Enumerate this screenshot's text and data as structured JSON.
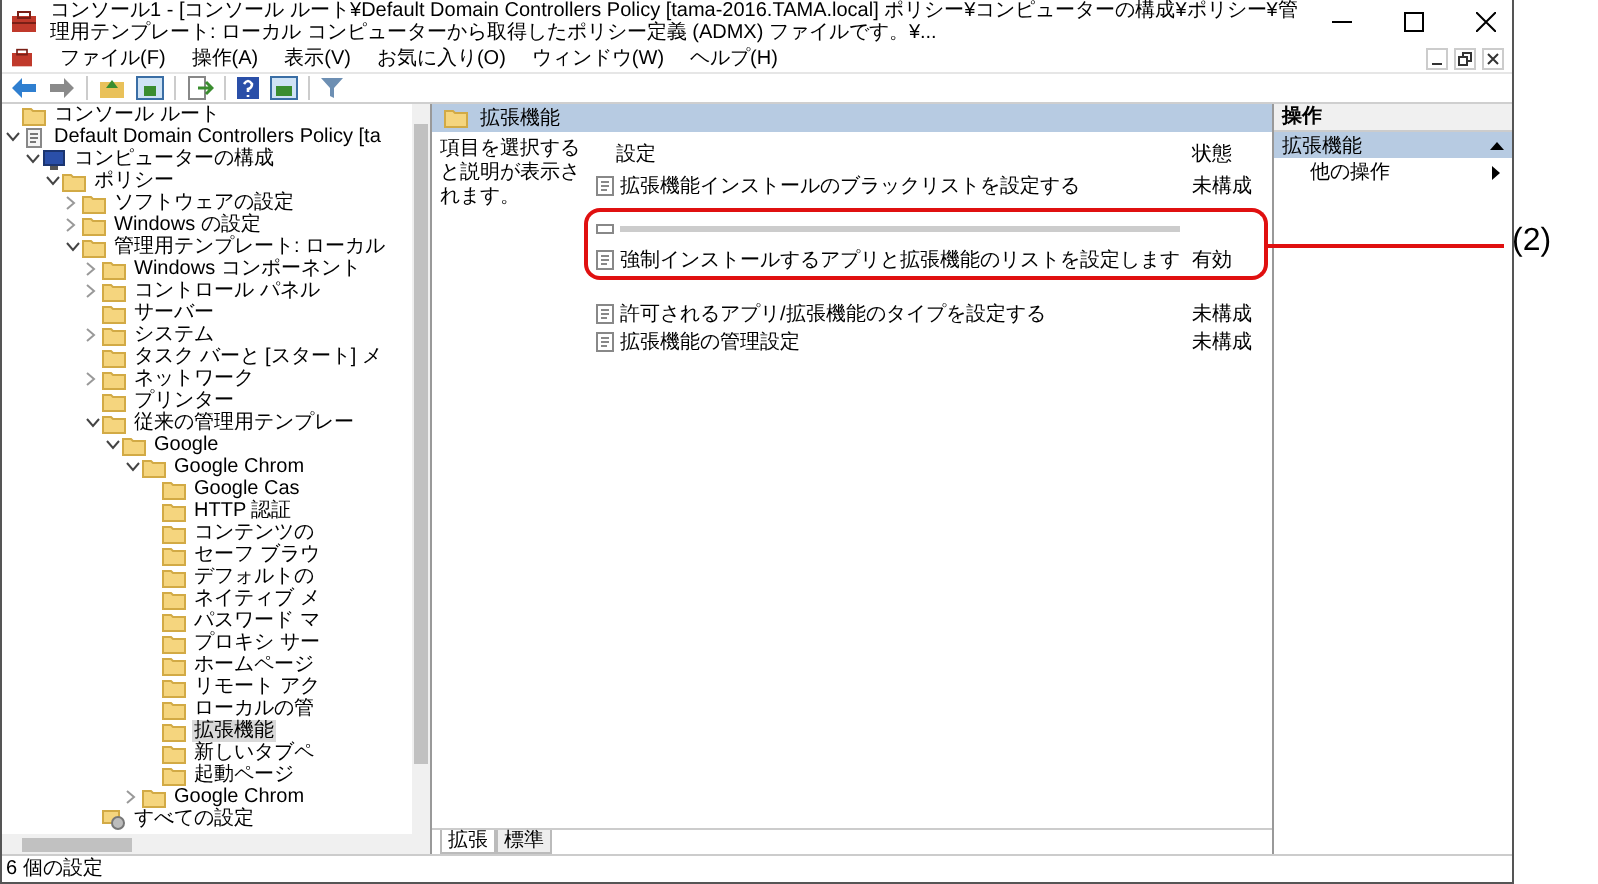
{
  "window": {
    "title": "コンソール1 - [コンソール ルート¥Default Domain Controllers Policy [tama-2016.TAMA.local] ポリシー¥コンピューターの構成¥ポリシー¥管理用テンプレート: ローカル コンピューターから取得したポリシー定義 (ADMX) ファイルです。¥..."
  },
  "menu": [
    "ファイル(F)",
    "操作(A)",
    "表示(V)",
    "お気に入り(O)",
    "ウィンドウ(W)",
    "ヘルプ(H)"
  ],
  "tree": [
    {
      "label": "コンソール ルート",
      "kind": "folder",
      "selected": false
    },
    {
      "label": "Default Domain Controllers Policy [ta",
      "kind": "policy",
      "expanded": true,
      "selected": false,
      "children": [
        {
          "label": "コンピューターの構成",
          "kind": "computer",
          "expanded": true,
          "selected": false,
          "children": [
            {
              "label": "ポリシー",
              "kind": "folder",
              "expanded": true,
              "selected": false,
              "children": [
                {
                  "label": "ソフトウェアの設定",
                  "kind": "folder",
                  "expanded": false,
                  "selected": false
                },
                {
                  "label": "Windows の設定",
                  "kind": "folder",
                  "expanded": false,
                  "selected": false
                },
                {
                  "label": "管理用テンプレート: ローカル",
                  "kind": "folder",
                  "expanded": true,
                  "selected": false,
                  "children": [
                    {
                      "label": "Windows コンポーネント",
                      "kind": "folder",
                      "expanded": false,
                      "selected": false
                    },
                    {
                      "label": "コントロール パネル",
                      "kind": "folder",
                      "expanded": false,
                      "selected": false
                    },
                    {
                      "label": "サーバー",
                      "kind": "folder",
                      "selected": false
                    },
                    {
                      "label": "システム",
                      "kind": "folder",
                      "expanded": false,
                      "selected": false
                    },
                    {
                      "label": "タスク バーと [スタート] メ",
                      "kind": "folder",
                      "selected": false
                    },
                    {
                      "label": "ネットワーク",
                      "kind": "folder",
                      "expanded": false,
                      "selected": false
                    },
                    {
                      "label": "プリンター",
                      "kind": "folder",
                      "selected": false
                    },
                    {
                      "label": "従来の管理用テンプレー",
                      "kind": "folder",
                      "expanded": true,
                      "selected": false,
                      "children": [
                        {
                          "label": "Google",
                          "kind": "folder",
                          "expanded": true,
                          "selected": false,
                          "children": [
                            {
                              "label": "Google Chrom",
                              "kind": "folder",
                              "expanded": true,
                              "selected": false,
                              "children": [
                                {
                                  "label": "Google Cas",
                                  "kind": "folder",
                                  "selected": false
                                },
                                {
                                  "label": "HTTP 認証",
                                  "kind": "folder",
                                  "selected": false
                                },
                                {
                                  "label": "コンテンツの",
                                  "kind": "folder",
                                  "selected": false
                                },
                                {
                                  "label": "セーフ ブラウ",
                                  "kind": "folder",
                                  "selected": false
                                },
                                {
                                  "label": "デフォルトの",
                                  "kind": "folder",
                                  "selected": false
                                },
                                {
                                  "label": "ネイティブ メ",
                                  "kind": "folder",
                                  "selected": false
                                },
                                {
                                  "label": "パスワード マ",
                                  "kind": "folder",
                                  "selected": false
                                },
                                {
                                  "label": "プロキシ サー",
                                  "kind": "folder",
                                  "selected": false
                                },
                                {
                                  "label": "ホームページ",
                                  "kind": "folder",
                                  "selected": false
                                },
                                {
                                  "label": "リモート アク",
                                  "kind": "folder",
                                  "selected": false
                                },
                                {
                                  "label": "ローカルの管",
                                  "kind": "folder",
                                  "selected": false
                                },
                                {
                                  "label": "拡張機能",
                                  "kind": "folder",
                                  "selected": true
                                },
                                {
                                  "label": "新しいタブペ",
                                  "kind": "folder",
                                  "selected": false
                                },
                                {
                                  "label": "起動ページ",
                                  "kind": "folder",
                                  "selected": false
                                }
                              ]
                            },
                            {
                              "label": "Google Chrom",
                              "kind": "folder",
                              "expanded": false,
                              "selected": false
                            }
                          ]
                        }
                      ]
                    },
                    {
                      "label": "すべての設定",
                      "kind": "settings",
                      "selected": false
                    }
                  ]
                }
              ]
            }
          ]
        }
      ]
    }
  ],
  "details_pane": {
    "header": "拡張機能",
    "description": "項目を選択すると説明が表示されます。",
    "columns": [
      "設定",
      "状態"
    ],
    "rows": [
      {
        "kind": "setting",
        "name": "拡張機能インストールのブラックリストを設定する",
        "status": "未構成",
        "highlighted": false
      },
      {
        "kind": "obscured",
        "highlighted": true
      },
      {
        "kind": "setting",
        "name": "強制インストールするアプリと拡張機能のリストを設定します",
        "status": "有効",
        "highlighted": true
      },
      {
        "kind": "setting",
        "name": "許可されるアプリ/拡張機能のタイプを設定する",
        "status": "未構成",
        "highlighted": false
      },
      {
        "kind": "setting",
        "name": "拡張機能の管理設定",
        "status": "未構成",
        "highlighted": false
      }
    ],
    "tabs": [
      {
        "label": "拡張",
        "selected": true
      },
      {
        "label": "標準",
        "selected": false
      }
    ]
  },
  "actions_pane": {
    "title": "操作",
    "section": {
      "label": "拡張機能",
      "expanded": true
    },
    "items": [
      "他の操作"
    ]
  },
  "status_bar": "6 個の設定",
  "annotation": {
    "label": "(2)"
  }
}
